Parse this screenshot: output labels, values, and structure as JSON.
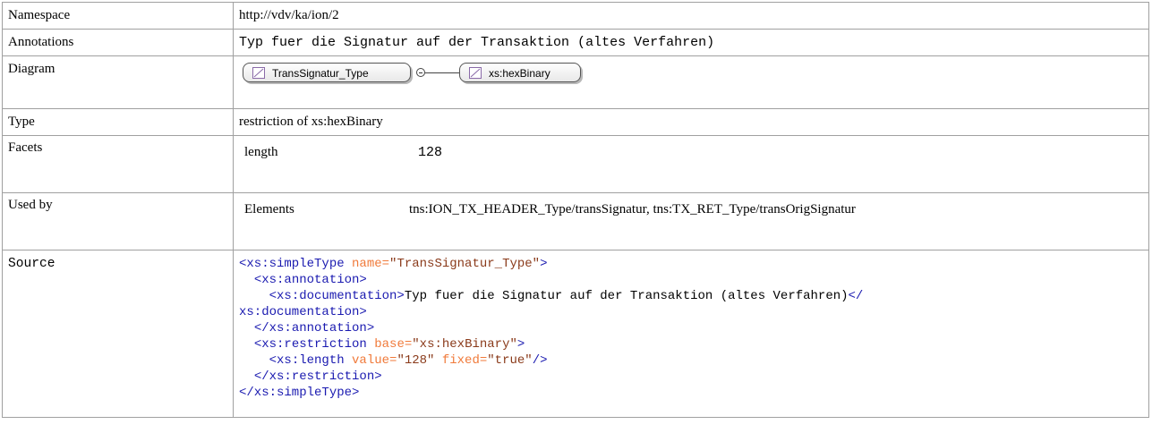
{
  "rows": {
    "namespace": {
      "label": "Namespace",
      "value": "http://vdv/ka/ion/2"
    },
    "annotations": {
      "label": "Annotations",
      "value": "Typ fuer die Signatur auf der Transaktion (altes Verfahren)"
    },
    "diagram": {
      "label": "Diagram",
      "node1": "TransSignatur_Type",
      "node2": "xs:hexBinary"
    },
    "type": {
      "label": "Type",
      "value": "restriction of xs:hexBinary"
    },
    "facets": {
      "label": "Facets",
      "name": "length",
      "value": "128"
    },
    "used_by": {
      "label": "Used by",
      "name": "Elements",
      "value": "tns:ION_TX_HEADER_Type/transSignatur, tns:TX_RET_Type/transOrigSignatur"
    },
    "source": {
      "label": "Source",
      "lines": [
        "<xs:simpleType",
        " name=",
        "\"TransSignatur_Type\"",
        ">",
        "<xs:annotation>",
        "<xs:documentation>",
        "Typ fuer die Signatur auf der Transaktion (altes Verfahren)",
        "</",
        "xs:documentation>",
        "</xs:annotation>",
        "<xs:restriction",
        " base=",
        "\"xs:hexBinary\"",
        ">",
        "<xs:length",
        " value=",
        "\"128\"",
        " fixed=",
        "\"true\"",
        "/>",
        "</xs:restriction>",
        "</xs:simpleType>"
      ]
    }
  },
  "colors": {
    "tag": "#1a1ab0",
    "attribute": "#f07a3a",
    "value": "#8a3a1a",
    "border": "#a0a0a0"
  },
  "icons": {
    "node_icon": "simple-type-icon",
    "connector": "sequence-connector-icon"
  }
}
